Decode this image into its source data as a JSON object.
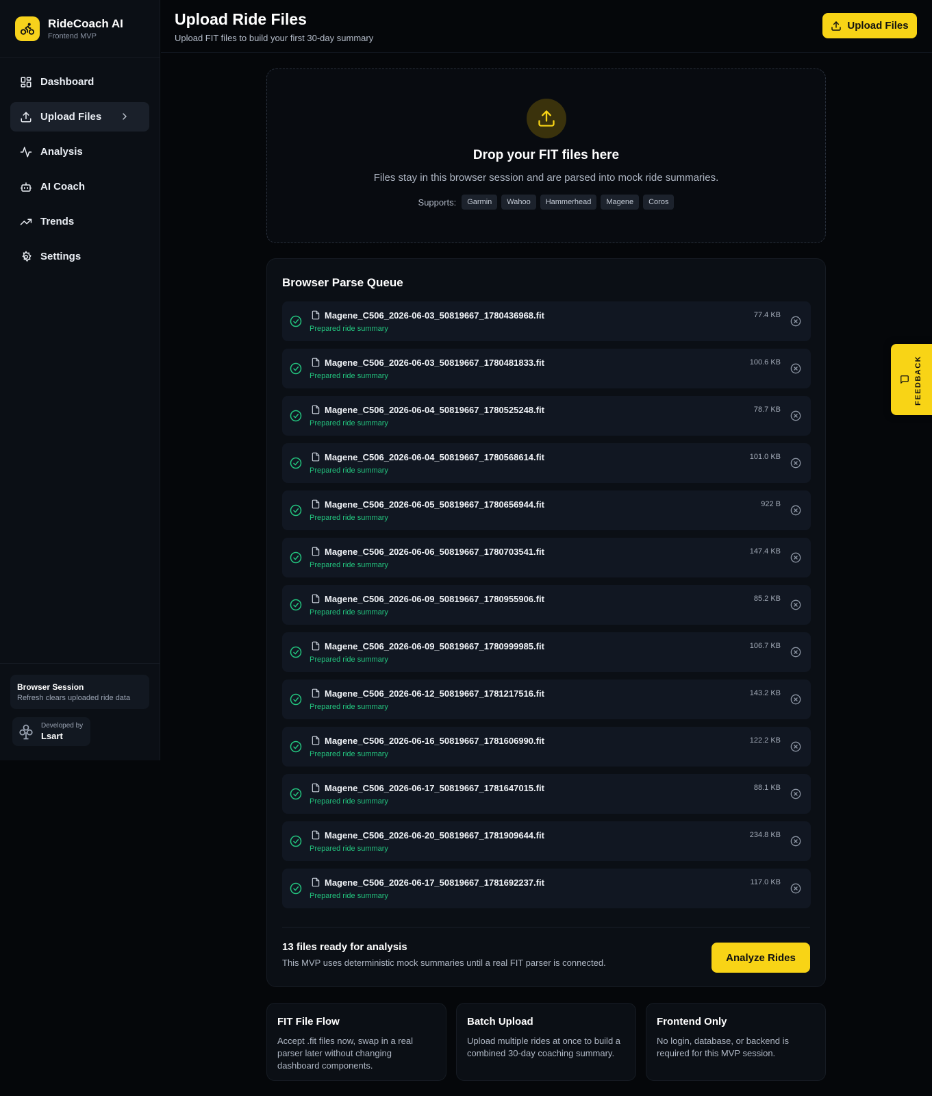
{
  "brand": {
    "name": "RideCoach AI",
    "subtitle": "Frontend MVP"
  },
  "nav": {
    "dashboard": "Dashboard",
    "upload": "Upload Files",
    "analysis": "Analysis",
    "coach": "AI Coach",
    "trends": "Trends",
    "settings": "Settings"
  },
  "session": {
    "title": "Browser Session",
    "text": "Refresh clears uploaded ride data"
  },
  "developer": {
    "label": "Developed by",
    "name": "Lsart"
  },
  "header": {
    "title": "Upload Ride Files",
    "subtitle": "Upload FIT files to build your first 30-day summary",
    "upload_button": "Upload Files"
  },
  "dropzone": {
    "title": "Drop your FIT files here",
    "subtitle": "Files stay in this browser session and are parsed into mock ride summaries.",
    "supports_label": "Supports:",
    "brands": [
      "Garmin",
      "Wahoo",
      "Hammerhead",
      "Magene",
      "Coros"
    ]
  },
  "queue": {
    "title": "Browser Parse Queue",
    "files": [
      {
        "name": "Magene_C506_2026-06-03_50819667_1780436968.fit",
        "status": "Prepared ride summary",
        "size": "77.4 KB"
      },
      {
        "name": "Magene_C506_2026-06-03_50819667_1780481833.fit",
        "status": "Prepared ride summary",
        "size": "100.6 KB"
      },
      {
        "name": "Magene_C506_2026-06-04_50819667_1780525248.fit",
        "status": "Prepared ride summary",
        "size": "78.7 KB"
      },
      {
        "name": "Magene_C506_2026-06-04_50819667_1780568614.fit",
        "status": "Prepared ride summary",
        "size": "101.0 KB"
      },
      {
        "name": "Magene_C506_2026-06-05_50819667_1780656944.fit",
        "status": "Prepared ride summary",
        "size": "922 B"
      },
      {
        "name": "Magene_C506_2026-06-06_50819667_1780703541.fit",
        "status": "Prepared ride summary",
        "size": "147.4 KB"
      },
      {
        "name": "Magene_C506_2026-06-09_50819667_1780955906.fit",
        "status": "Prepared ride summary",
        "size": "85.2 KB"
      },
      {
        "name": "Magene_C506_2026-06-09_50819667_1780999985.fit",
        "status": "Prepared ride summary",
        "size": "106.7 KB"
      },
      {
        "name": "Magene_C506_2026-06-12_50819667_1781217516.fit",
        "status": "Prepared ride summary",
        "size": "143.2 KB"
      },
      {
        "name": "Magene_C506_2026-06-16_50819667_1781606990.fit",
        "status": "Prepared ride summary",
        "size": "122.2 KB"
      },
      {
        "name": "Magene_C506_2026-06-17_50819667_1781647015.fit",
        "status": "Prepared ride summary",
        "size": "88.1 KB"
      },
      {
        "name": "Magene_C506_2026-06-20_50819667_1781909644.fit",
        "status": "Prepared ride summary",
        "size": "234.8 KB"
      },
      {
        "name": "Magene_C506_2026-06-17_50819667_1781692237.fit",
        "status": "Prepared ride summary",
        "size": "117.0 KB"
      }
    ],
    "ready_title": "13 files ready for analysis",
    "ready_text": "This MVP uses deterministic mock summaries until a real FIT parser is connected.",
    "analyze_button": "Analyze Rides"
  },
  "cards": [
    {
      "title": "FIT File Flow",
      "text": "Accept .fit files now, swap in a real parser later without changing dashboard components."
    },
    {
      "title": "Batch Upload",
      "text": "Upload multiple rides at once to build a combined 30-day coaching summary."
    },
    {
      "title": "Frontend Only",
      "text": "No login, database, or backend is required for this MVP session."
    }
  ],
  "feedback": {
    "label": "FEEDBACK"
  },
  "colors": {
    "accent": "#f8d416",
    "success": "#23c57f",
    "background": "#05070a",
    "panel": "#0b0f15"
  },
  "icons": {
    "logo": "bike-icon",
    "dashboard": "grid-icon",
    "upload": "upload-icon",
    "analysis": "pulse-icon",
    "coach": "bot-icon",
    "trends": "trending-up-icon",
    "settings": "gear-icon",
    "row_status": "check-circle-icon",
    "row_file": "file-icon",
    "row_remove": "x-circle-icon",
    "feedback": "message-icon"
  }
}
